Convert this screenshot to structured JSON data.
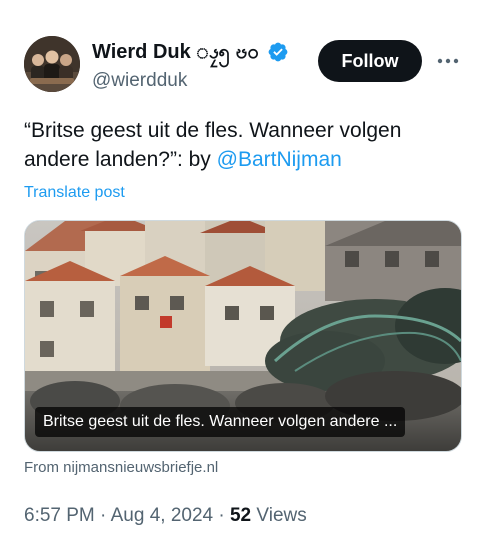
{
  "author": {
    "display_name": "Wierd Duk ၖၠ၅ ၓ၀",
    "handle": "@wierdduk",
    "verified_icon": "verified-badge-icon",
    "avatar_icon": "avatar-photo"
  },
  "actions": {
    "follow_label": "Follow",
    "more_icon": "more-horizontal-icon"
  },
  "post": {
    "text_before": "“Britse geest uit de fles. Wanneer volgen andere landen?”: by ",
    "mention": "@BartNijman",
    "translate_label": "Translate post"
  },
  "link_card": {
    "title": "Britse geest uit de fles. Wanneer volgen andere ...",
    "source": "From nijmansnieuwsbriefje.nl"
  },
  "meta": {
    "time": "6:57 PM",
    "separator": "·",
    "date": "Aug 4, 2024",
    "views_count": "52",
    "views_label": "Views"
  },
  "colors": {
    "accent": "#1d9bf0",
    "text_primary": "#0f1419",
    "text_secondary": "#536471",
    "button_bg": "#0f1419"
  }
}
